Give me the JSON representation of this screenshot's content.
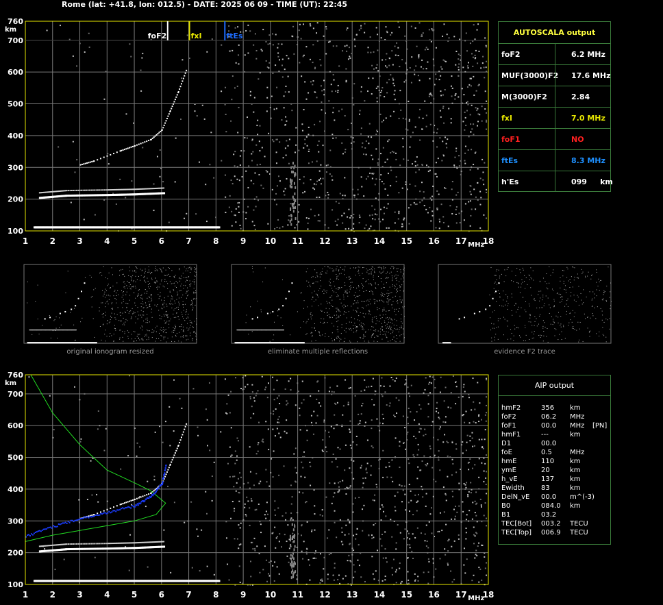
{
  "header": "Rome (lat: +41.8, lon: 012.5) - DATE: 2025 06 09 - TIME (UT): 22:45",
  "chart_data": {
    "type": "scatter",
    "xlabel": "MHz",
    "ylabel": "km",
    "x_ticks": [
      1,
      2,
      3,
      4,
      5,
      6,
      7,
      8,
      9,
      10,
      11,
      12,
      13,
      14,
      15,
      16,
      17,
      18
    ],
    "y_ticks": [
      100,
      200,
      300,
      400,
      500,
      600,
      700,
      760
    ],
    "xlim": [
      1,
      18
    ],
    "ylim": [
      100,
      760
    ],
    "grid": true,
    "colors": {
      "axis": "#e8e800",
      "grid": "#7a7a7a",
      "trace": "#ffffff",
      "profile": "#22dd22",
      "aip_trace": "#1a3cff"
    },
    "markers": [
      {
        "label": "foF2",
        "freq": 6.2,
        "color": "#ffffff"
      },
      {
        "label": "fxI",
        "freq": 7.0,
        "color": "#e8e800"
      },
      {
        "label": "ftEs",
        "freq": 8.3,
        "color": "#1e6cff"
      }
    ],
    "es_trace": {
      "f_start": 1.3,
      "f_end": 8.1,
      "height": 110
    },
    "f_trace_lower": [
      [
        1.5,
        205
      ],
      [
        2.5,
        212
      ],
      [
        4.0,
        214
      ],
      [
        5.0,
        216
      ],
      [
        6.1,
        220
      ]
    ],
    "f_trace": [
      [
        3.0,
        310
      ],
      [
        3.5,
        322
      ],
      [
        4.5,
        355
      ],
      [
        5.0,
        370
      ],
      [
        5.6,
        390
      ],
      [
        6.0,
        420
      ],
      [
        6.3,
        480
      ],
      [
        6.6,
        540
      ],
      [
        6.9,
        610
      ]
    ],
    "profile_curve": [
      [
        1.0,
        235
      ],
      [
        2.0,
        255
      ],
      [
        3.0,
        270
      ],
      [
        4.0,
        285
      ],
      [
        5.0,
        300
      ],
      [
        5.8,
        320
      ],
      [
        6.15,
        356
      ],
      [
        5.6,
        395
      ],
      [
        5.0,
        420
      ],
      [
        4.0,
        460
      ],
      [
        3.0,
        540
      ],
      [
        2.0,
        640
      ],
      [
        1.2,
        760
      ]
    ],
    "aip_trace": [
      [
        1.0,
        255
      ],
      [
        2.0,
        285
      ],
      [
        3.0,
        310
      ],
      [
        4.0,
        330
      ],
      [
        5.0,
        350
      ],
      [
        5.6,
        380
      ],
      [
        6.0,
        420
      ],
      [
        6.15,
        480
      ]
    ]
  },
  "thumbnails": [
    {
      "caption": "original ionogram resized"
    },
    {
      "caption": "eliminate multiple reflections"
    },
    {
      "caption": "evidence F2 trace"
    }
  ],
  "autoscala": {
    "title": "AUTOSCALA output",
    "rows": [
      {
        "label": "foF2",
        "value": "6.2 MHz",
        "color": "#ffffff"
      },
      {
        "label": "MUF(3000)F2",
        "value": "17.6 MHz",
        "color": "#ffffff"
      },
      {
        "label": "M(3000)F2",
        "value": "2.84",
        "color": "#ffffff"
      },
      {
        "label": "fxI",
        "value": "7.0 MHz",
        "color": "#e8e800"
      },
      {
        "label": "foF1",
        "value": "NO",
        "color": "#ff2020"
      },
      {
        "label": "ftEs",
        "value": "8.3 MHz",
        "color": "#1e90ff"
      },
      {
        "label": "h'Es",
        "value": "099     km",
        "color": "#ffffff"
      }
    ]
  },
  "aip": {
    "title": "AIP output",
    "rows": [
      {
        "name": "hmF2",
        "value": "356",
        "unit": "km",
        "extra": ""
      },
      {
        "name": "foF2",
        "value": "06.2",
        "unit": "MHz",
        "extra": ""
      },
      {
        "name": "foF1",
        "value": "00.0",
        "unit": "MHz",
        "extra": "[PN]"
      },
      {
        "name": "hmF1",
        "value": "---",
        "unit": "km",
        "extra": ""
      },
      {
        "name": "D1",
        "value": "00.0",
        "unit": "",
        "extra": ""
      },
      {
        "name": "foE",
        "value": "0.5",
        "unit": "MHz",
        "extra": ""
      },
      {
        "name": "hmE",
        "value": "110",
        "unit": "km",
        "extra": ""
      },
      {
        "name": "ymE",
        "value": "20",
        "unit": "km",
        "extra": ""
      },
      {
        "name": "h_vE",
        "value": "137",
        "unit": "km",
        "extra": ""
      },
      {
        "name": "Ewidth",
        "value": "83",
        "unit": "km",
        "extra": ""
      },
      {
        "name": "DelN_vE",
        "value": "00.0",
        "unit": "m^(-3)",
        "extra": ""
      },
      {
        "name": "B0",
        "value": "084.0",
        "unit": "km",
        "extra": ""
      },
      {
        "name": "B1",
        "value": "03.2",
        "unit": "",
        "extra": ""
      },
      {
        "name": "TEC[Bot]",
        "value": "003.2",
        "unit": "TECU",
        "extra": ""
      },
      {
        "name": "TEC[Top]",
        "value": "006.9",
        "unit": "TECU",
        "extra": ""
      }
    ]
  }
}
